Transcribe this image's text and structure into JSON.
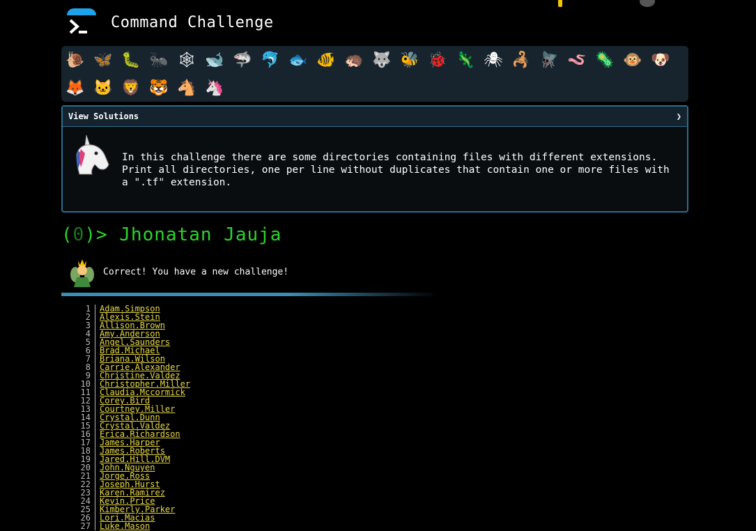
{
  "header": {
    "title": "Command Challenge"
  },
  "toolbar": {
    "icons": [
      {
        "name": "snail-icon",
        "glyph": "🐌"
      },
      {
        "name": "butterfly-icon",
        "glyph": "🦋"
      },
      {
        "name": "caterpillar-icon",
        "glyph": "🐛"
      },
      {
        "name": "ant-icon",
        "glyph": "🐜"
      },
      {
        "name": "spider-web-icon",
        "glyph": "🕸"
      },
      {
        "name": "whale-icon",
        "glyph": "🐋"
      },
      {
        "name": "shark-icon",
        "glyph": "🦈"
      },
      {
        "name": "dolphin-icon",
        "glyph": "🐬"
      },
      {
        "name": "fish-icon",
        "glyph": "🐟"
      },
      {
        "name": "tropical-fish-icon",
        "glyph": "🐠"
      },
      {
        "name": "hedgehog-icon",
        "glyph": "🦔"
      },
      {
        "name": "wolf-icon",
        "glyph": "🐺"
      },
      {
        "name": "bee-icon",
        "glyph": "🐝"
      },
      {
        "name": "ladybug-icon",
        "glyph": "🐞"
      },
      {
        "name": "lizard-icon",
        "glyph": "🦎"
      },
      {
        "name": "spider-icon",
        "glyph": "🕷"
      },
      {
        "name": "scorpion-icon",
        "glyph": "🦂"
      },
      {
        "name": "fly-icon",
        "glyph": "🪰"
      },
      {
        "name": "worm-icon",
        "glyph": "🪱"
      },
      {
        "name": "microbe-icon",
        "glyph": "🦠"
      },
      {
        "name": "monkey-icon",
        "glyph": "🐵"
      },
      {
        "name": "dog-icon",
        "glyph": "🐶"
      },
      {
        "name": "fox-icon",
        "glyph": "🦊"
      },
      {
        "name": "cat-icon",
        "glyph": "🐱"
      },
      {
        "name": "lion-icon",
        "glyph": "🦁"
      },
      {
        "name": "tiger-icon",
        "glyph": "🐯"
      },
      {
        "name": "horse-icon",
        "glyph": "🐴"
      },
      {
        "name": "unicorn-icon",
        "glyph": "🦄"
      }
    ]
  },
  "panel": {
    "header_label": "View Solutions",
    "chevron": "❯",
    "challenge_text": "In this challenge there are some directories containing files with different extensions.\nPrint all directories, one per line without duplicates that contain one or more files with\na \".tf\" extension."
  },
  "prompt": {
    "open": "(",
    "count": "0",
    "close": ")>",
    "user": "Jhonatan Jauja"
  },
  "status": {
    "message": "Correct! You have a new challenge!"
  },
  "output": {
    "lines": [
      {
        "n": "1",
        "v": "Adam.Simpson"
      },
      {
        "n": "2",
        "v": "Alexis.Stein"
      },
      {
        "n": "3",
        "v": "Allison.Brown"
      },
      {
        "n": "4",
        "v": "Amy.Anderson"
      },
      {
        "n": "5",
        "v": "Angel.Saunders"
      },
      {
        "n": "6",
        "v": "Brad.Michael"
      },
      {
        "n": "7",
        "v": "Briana.Wilson"
      },
      {
        "n": "8",
        "v": "Carrie.Alexander"
      },
      {
        "n": "9",
        "v": "Christine.Valdez"
      },
      {
        "n": "10",
        "v": "Christopher.Miller"
      },
      {
        "n": "11",
        "v": "Claudia.Mccormick"
      },
      {
        "n": "12",
        "v": "Corey.Bird"
      },
      {
        "n": "13",
        "v": "Courtney.Miller"
      },
      {
        "n": "14",
        "v": "Crystal.Dunn"
      },
      {
        "n": "15",
        "v": "Crystal.Valdez"
      },
      {
        "n": "16",
        "v": "Erica.Richardson"
      },
      {
        "n": "17",
        "v": "James.Harper"
      },
      {
        "n": "18",
        "v": "James.Roberts"
      },
      {
        "n": "19",
        "v": "Jared.Hill.DVM"
      },
      {
        "n": "20",
        "v": "John.Nguyen"
      },
      {
        "n": "21",
        "v": "Jorge.Ross"
      },
      {
        "n": "22",
        "v": "Joseph.Hurst"
      },
      {
        "n": "23",
        "v": "Karen.Ramirez"
      },
      {
        "n": "24",
        "v": "Kevin.Price"
      },
      {
        "n": "25",
        "v": "Kimberly.Parker"
      },
      {
        "n": "26",
        "v": "Lori.Macias"
      },
      {
        "n": "27",
        "v": "Luke.Mason"
      }
    ]
  }
}
